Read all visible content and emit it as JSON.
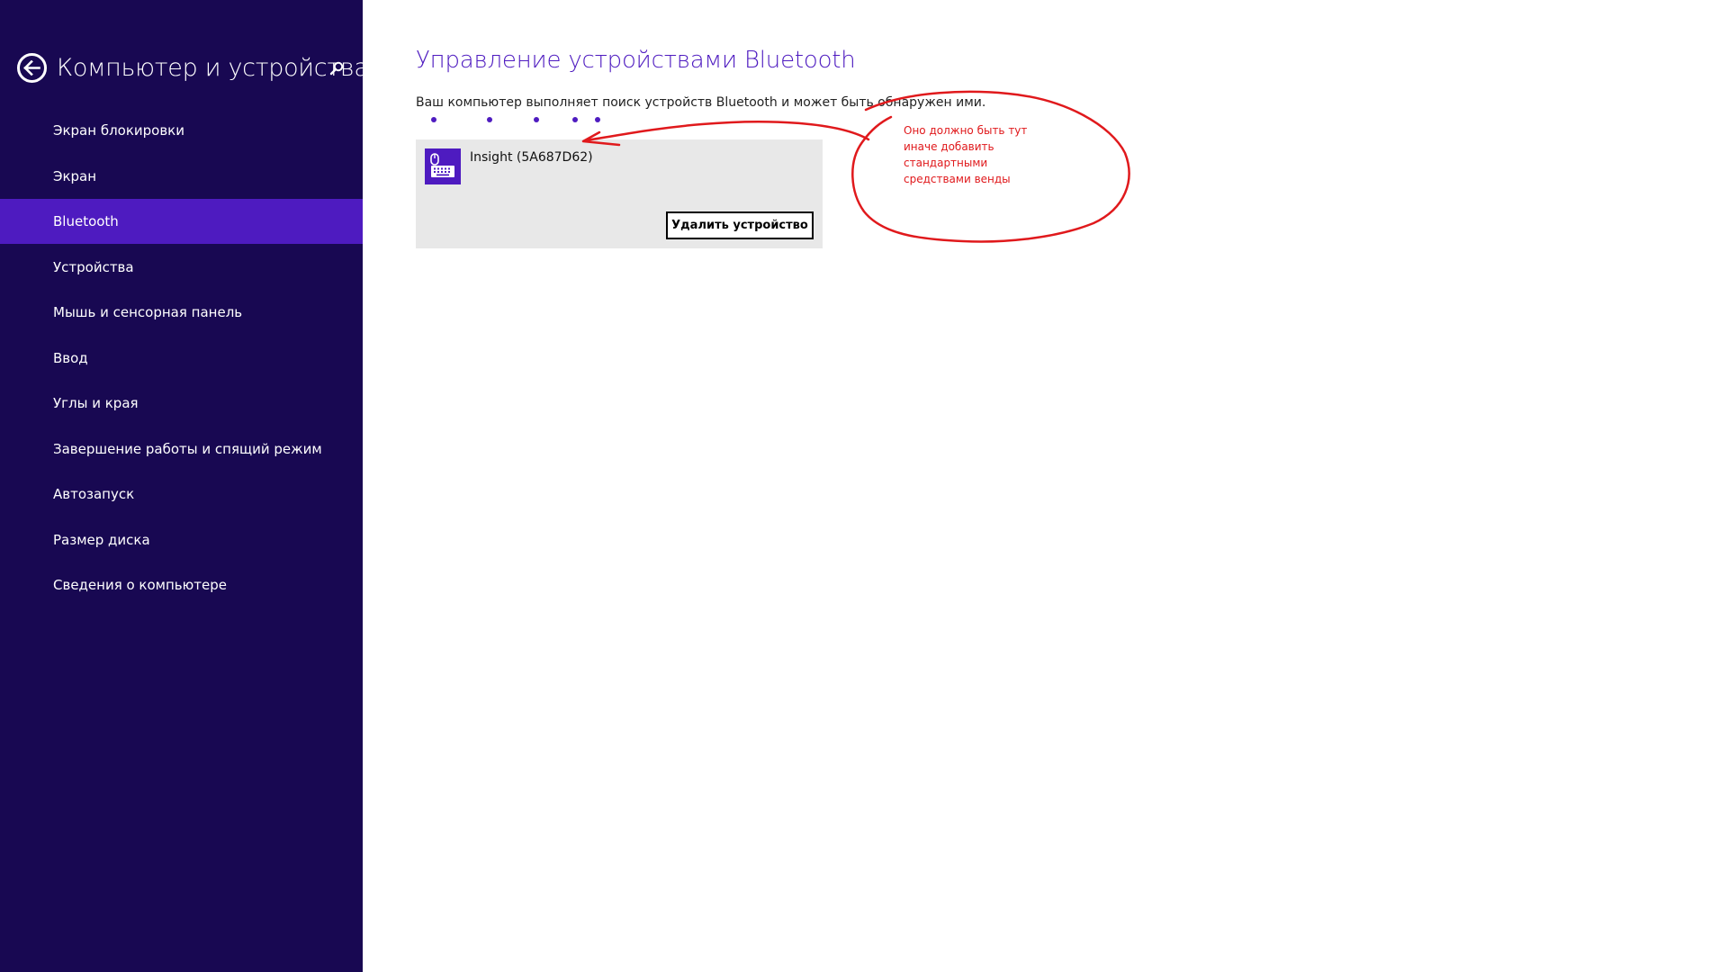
{
  "sidebar": {
    "title": "Компьютер и устройства",
    "back_icon": "back-arrow-icon",
    "search_icon": "search-icon",
    "items": [
      {
        "label": "Экран блокировки",
        "active": false
      },
      {
        "label": "Экран",
        "active": false
      },
      {
        "label": "Bluetooth",
        "active": true
      },
      {
        "label": "Устройства",
        "active": false
      },
      {
        "label": "Мышь и сенсорная панель",
        "active": false
      },
      {
        "label": "Ввод",
        "active": false
      },
      {
        "label": "Углы и края",
        "active": false
      },
      {
        "label": "Завершение работы и спящий режим",
        "active": false
      },
      {
        "label": "Автозапуск",
        "active": false
      },
      {
        "label": "Размер диска",
        "active": false
      },
      {
        "label": "Сведения о компьютере",
        "active": false
      }
    ]
  },
  "main": {
    "title": "Управление устройствами Bluetooth",
    "status": "Ваш компьютер выполняет поиск устройств Bluetooth и может быть обнаружен ими.",
    "device": {
      "name": "Insight (5A687D62)",
      "icon": "mouse-keyboard-icon",
      "remove_label": "Удалить устройство"
    }
  },
  "annotation": {
    "lines": [
      "Оно должно быть тут",
      "иначе добавить",
      "стандартными",
      "средствами венды"
    ]
  },
  "colors": {
    "sidebar_bg": "#180852",
    "accent": "#4e1bc0",
    "tile_bg": "#e8e8e8",
    "annotation": "#e0191c"
  }
}
